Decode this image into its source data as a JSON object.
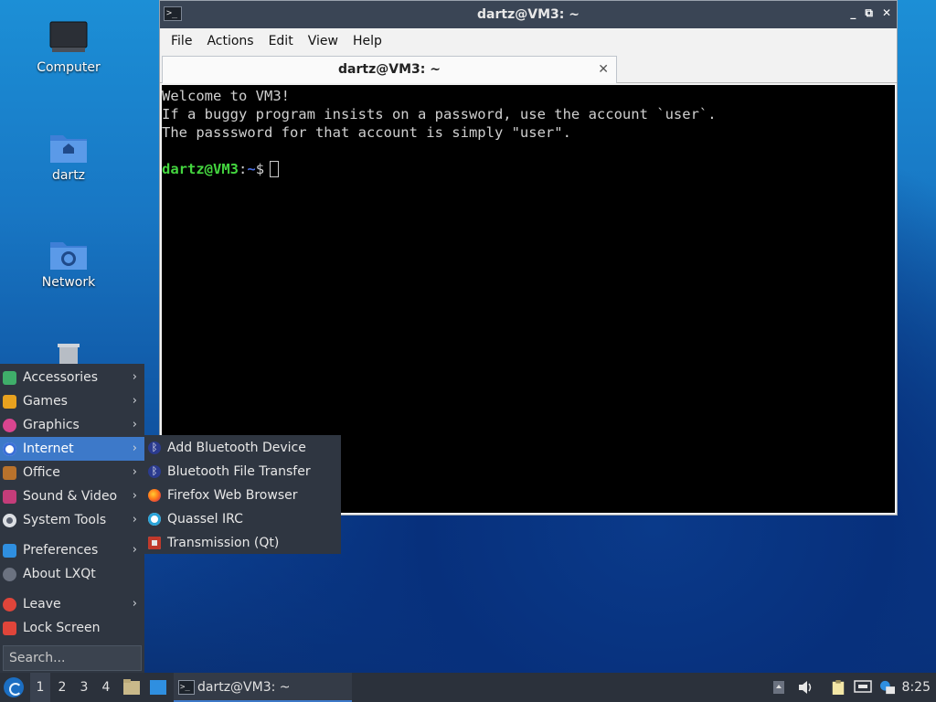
{
  "desktop": {
    "icons": [
      {
        "label": "Computer"
      },
      {
        "label": "dartz"
      },
      {
        "label": "Network"
      }
    ]
  },
  "window": {
    "title": "dartz@VM3: ~",
    "controls": {
      "minimize": "_",
      "restore": "⧉",
      "close": "✕"
    },
    "menu": [
      "File",
      "Actions",
      "Edit",
      "View",
      "Help"
    ],
    "tab": {
      "label": "dartz@VM3: ~",
      "close": "✕"
    },
    "terminal": {
      "lines": [
        "Welcome to VM3!",
        "If a buggy program insists on a password, use the account `user`.",
        "The passsword for that account is simply \"user\"."
      ],
      "prompt_user": "dartz@VM3",
      "prompt_sep": ":",
      "prompt_path": "~",
      "prompt_symbol": "$"
    }
  },
  "start_menu": {
    "categories": [
      {
        "label": "Accessories",
        "icon": "accessories-icon",
        "color": "#3fae6a"
      },
      {
        "label": "Games",
        "icon": "games-icon",
        "color": "#e8a21f"
      },
      {
        "label": "Graphics",
        "icon": "graphics-icon",
        "color": "#d9458f"
      },
      {
        "label": "Internet",
        "icon": "internet-icon",
        "color": "#3b6fd8"
      },
      {
        "label": "Office",
        "icon": "office-icon",
        "color": "#b8722c"
      },
      {
        "label": "Sound & Video",
        "icon": "sound-video-icon",
        "color": "#c43d7a"
      },
      {
        "label": "System Tools",
        "icon": "system-tools-icon",
        "color": "#5a6170"
      }
    ],
    "system": [
      {
        "label": "Preferences",
        "icon": "preferences-icon",
        "color": "#2f8fe0"
      },
      {
        "label": "About LXQt",
        "icon": "info-icon",
        "color": "#6b7280"
      }
    ],
    "session": [
      {
        "label": "Leave",
        "icon": "power-icon",
        "color": "#e0453a"
      },
      {
        "label": "Lock Screen",
        "icon": "lock-icon",
        "color": "#e0453a"
      }
    ],
    "search_placeholder": "Search...",
    "active_item": "Internet",
    "arrow": "›"
  },
  "internet_submenu": [
    {
      "label": "Add Bluetooth Device",
      "icon": "bluetooth-icon",
      "glyph": "ᛒ",
      "color": "#2b3b8f"
    },
    {
      "label": "Bluetooth File Transfer",
      "icon": "bluetooth-icon",
      "glyph": "ᛒ",
      "color": "#2b3b8f"
    },
    {
      "label": "Firefox Web Browser",
      "icon": "firefox-icon",
      "glyph": "",
      "color": "#e66000"
    },
    {
      "label": "Quassel IRC",
      "icon": "quassel-icon",
      "glyph": "",
      "color": "#2aa3d8"
    },
    {
      "label": "Transmission (Qt)",
      "icon": "transmission-icon",
      "glyph": "",
      "color": "#c0392b"
    }
  ],
  "taskbar": {
    "desktops": [
      "1",
      "2",
      "3",
      "4"
    ],
    "active_desktop": "1",
    "task_label": "dartz@VM3: ~",
    "clock": "8:25"
  }
}
